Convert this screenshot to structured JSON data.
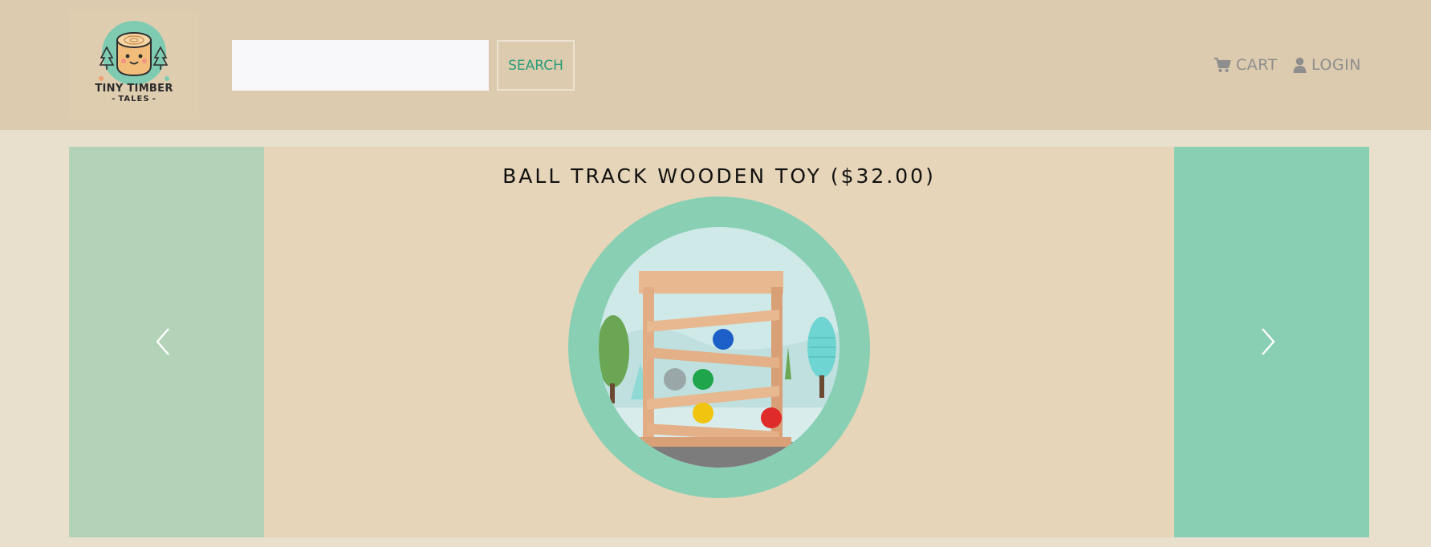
{
  "brand": {
    "name_line1": "TINY TIMBER",
    "name_line2": "TALES",
    "logo_icon": "tree-stump-icon"
  },
  "search": {
    "value": "",
    "placeholder": "",
    "button_label": "SEARCH"
  },
  "nav": {
    "cart": {
      "label": "CART",
      "icon": "cart-icon"
    },
    "login": {
      "label": "LOGIN",
      "icon": "user-icon"
    }
  },
  "carousel": {
    "title": "BALL TRACK WOODEN TOY ($32.00)",
    "image_alt": "Ball track wooden toy",
    "prev_icon": "chevron-left-icon",
    "next_icon": "chevron-right-icon"
  },
  "colors": {
    "header_bg": "#dccbae",
    "page_bg": "#e8dfcc",
    "slide_bg": "#e6d5b8",
    "prev_panel": "#b3d3b8",
    "next_panel": "#88cfb4",
    "accent": "#2a9d78"
  }
}
